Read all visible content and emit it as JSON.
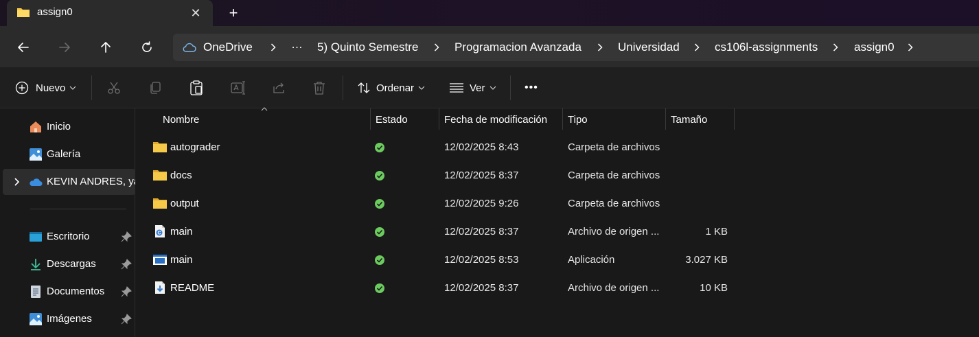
{
  "window": {
    "tab_title": "assign0",
    "close_symbol": "✕",
    "new_tab_symbol": "+"
  },
  "address": {
    "breadcrumbs": [
      "OneDrive",
      "…",
      "5) Quinto Semestre",
      "Programacion Avanzada",
      "Universidad",
      "cs106l-assignments",
      "assign0"
    ]
  },
  "toolbar": {
    "new_label": "Nuevo",
    "sort_label": "Ordenar",
    "view_label": "Ver",
    "more_label": "•••"
  },
  "sidebar": {
    "items": [
      {
        "label": "Inicio",
        "icon": "home-icon"
      },
      {
        "label": "Galería",
        "icon": "gallery-icon"
      },
      {
        "label": "KEVIN ANDRES, yac",
        "icon": "onedrive-cloud-icon"
      },
      {
        "label": "Escritorio",
        "icon": "desktop-icon"
      },
      {
        "label": "Descargas",
        "icon": "download-icon"
      },
      {
        "label": "Documentos",
        "icon": "documents-icon"
      },
      {
        "label": "Imágenes",
        "icon": "pictures-icon"
      }
    ]
  },
  "columns": {
    "name": "Nombre",
    "status": "Estado",
    "date": "Fecha de modificación",
    "type": "Tipo",
    "size": "Tamaño"
  },
  "files": [
    {
      "name": "autograder",
      "date": "12/02/2025 8:43",
      "type": "Carpeta de archivos",
      "size": "",
      "icon": "folder-icon"
    },
    {
      "name": "docs",
      "date": "12/02/2025 8:37",
      "type": "Carpeta de archivos",
      "size": "",
      "icon": "folder-icon"
    },
    {
      "name": "output",
      "date": "12/02/2025 9:26",
      "type": "Carpeta de archivos",
      "size": "",
      "icon": "folder-icon"
    },
    {
      "name": "main",
      "date": "12/02/2025 8:37",
      "type": "Archivo de origen ...",
      "size": "1 KB",
      "icon": "cpp-source-icon"
    },
    {
      "name": "main",
      "date": "12/02/2025 8:53",
      "type": "Aplicación",
      "size": "3.027 KB",
      "icon": "application-icon"
    },
    {
      "name": "README",
      "date": "12/02/2025 8:37",
      "type": "Archivo de origen ...",
      "size": "10 KB",
      "icon": "markdown-source-icon"
    }
  ],
  "colors": {
    "folder": "#f7c948",
    "status_ok": "#6ccb5f",
    "onedrive": "#3b8de0",
    "accent_blue": "#4ca0e0"
  }
}
